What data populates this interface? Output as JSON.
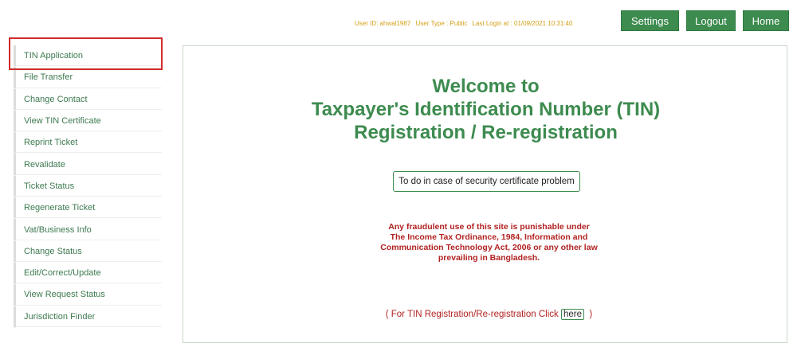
{
  "header": {
    "user_id": "User ID: ahwal1987",
    "user_type": "User Type : Public",
    "last_login": "Last Login at : 01/09/2021 10:31:40",
    "buttons": {
      "settings": "Settings",
      "logout": "Logout",
      "home": "Home"
    }
  },
  "sidebar": {
    "items": [
      {
        "label": "TIN Application"
      },
      {
        "label": "File Transfer"
      },
      {
        "label": "Change Contact"
      },
      {
        "label": "View TIN Certificate"
      },
      {
        "label": "Reprint Ticket"
      },
      {
        "label": "Revalidate"
      },
      {
        "label": "Ticket Status"
      },
      {
        "label": "Regenerate Ticket"
      },
      {
        "label": "Vat/Business Info"
      },
      {
        "label": "Change Status"
      },
      {
        "label": "Edit/Correct/Update"
      },
      {
        "label": "View Request Status"
      },
      {
        "label": "Jurisdiction Finder"
      }
    ]
  },
  "main": {
    "welcome_line1": "Welcome to",
    "welcome_line2": "Taxpayer's Identification Number (TIN)",
    "welcome_line3": "Registration / Re-registration",
    "cert_button": "To do in case of security certificate problem",
    "warning_line1": "Any fraudulent use of this site is punishable under",
    "warning_line2": "The Income Tax Ordinance, 1984, Information and",
    "warning_line3": "Communication Technology Act, 2006 or any other law",
    "warning_line4": "prevailing in Bangladesh.",
    "reg_prefix": "( For TIN Registration/Re-registration Click",
    "reg_link": "here",
    "reg_suffix": ")"
  },
  "colors": {
    "brand_green": "#3d8b4f",
    "warning_red": "#b22222",
    "userinfo_gold": "#d4a017",
    "highlight_red": "#d12a2a"
  }
}
